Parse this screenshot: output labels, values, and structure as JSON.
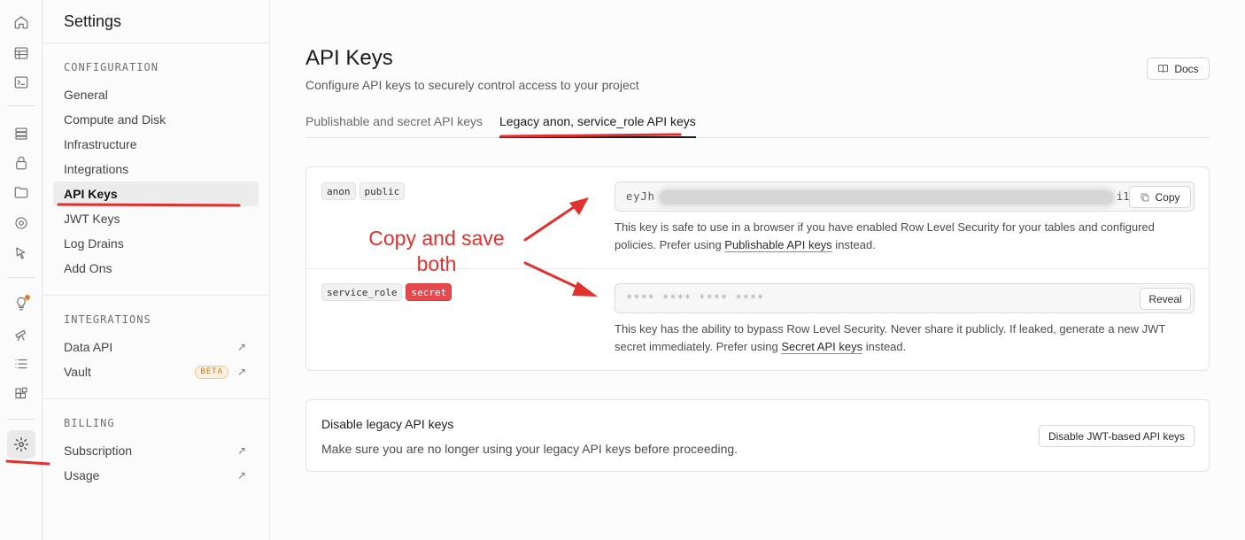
{
  "nav": {
    "title": "Settings",
    "sections": {
      "configuration": "CONFIGURATION",
      "integrations": "INTEGRATIONS",
      "billing": "BILLING"
    },
    "items": [
      {
        "label": "General"
      },
      {
        "label": "Compute and Disk"
      },
      {
        "label": "Infrastructure"
      },
      {
        "label": "Integrations"
      },
      {
        "label": "API Keys"
      },
      {
        "label": "JWT Keys"
      },
      {
        "label": "Log Drains"
      },
      {
        "label": "Add Ons"
      },
      {
        "label": "Data API"
      },
      {
        "label": "Vault",
        "badge": "BETA"
      },
      {
        "label": "Subscription"
      },
      {
        "label": "Usage"
      }
    ],
    "external_link_icon": "arrow-up-right-icon"
  },
  "rail": {
    "icons": [
      "home-icon",
      "table-editor-icon",
      "sql-editor-icon",
      "database-icon",
      "auth-lock-icon",
      "storage-folder-icon",
      "realtime-icon",
      "functions-icon",
      "advisors-bulb-icon",
      "observability-telescope-icon",
      "logs-list-icon",
      "integrations-icon",
      "settings-gear-icon"
    ],
    "notification_color": "#e87a2e"
  },
  "main": {
    "title": "API Keys",
    "subtitle": "Configure API keys to securely control access to your project",
    "docs_label": "Docs",
    "tabs": [
      {
        "label": "Publishable and secret API keys",
        "active": false
      },
      {
        "label": "Legacy anon, service_role API keys",
        "active": true
      }
    ]
  },
  "keys": {
    "anon": {
      "tags": [
        "anon",
        "public"
      ],
      "value_start": "eyJh",
      "value_end": "i1",
      "copy_label": "Copy",
      "help_before": "This key is safe to use in a browser if you have enabled Row Level Security for your tables and configured policies. Prefer using ",
      "help_link": "Publishable API keys",
      "help_after": " instead."
    },
    "service_role": {
      "tags": [
        "service_role"
      ],
      "secret_tag": "secret",
      "masked_value": "**** **** **** ****",
      "reveal_label": "Reveal",
      "help_before": "This key has the ability to bypass Row Level Security. Never share it publicly. If leaked, generate a new JWT secret immediately. Prefer using ",
      "help_link": "Secret API keys",
      "help_after": " instead."
    }
  },
  "disable": {
    "title": "Disable legacy API keys",
    "description": "Make sure you are no longer using your legacy API keys before proceeding.",
    "button_label": "Disable JWT-based API keys"
  },
  "annotation": {
    "line1": "Copy and save",
    "line2": "both",
    "color": "#e2302f"
  },
  "colors": {
    "danger": "#e5484d",
    "beta": "#c77a1a"
  }
}
